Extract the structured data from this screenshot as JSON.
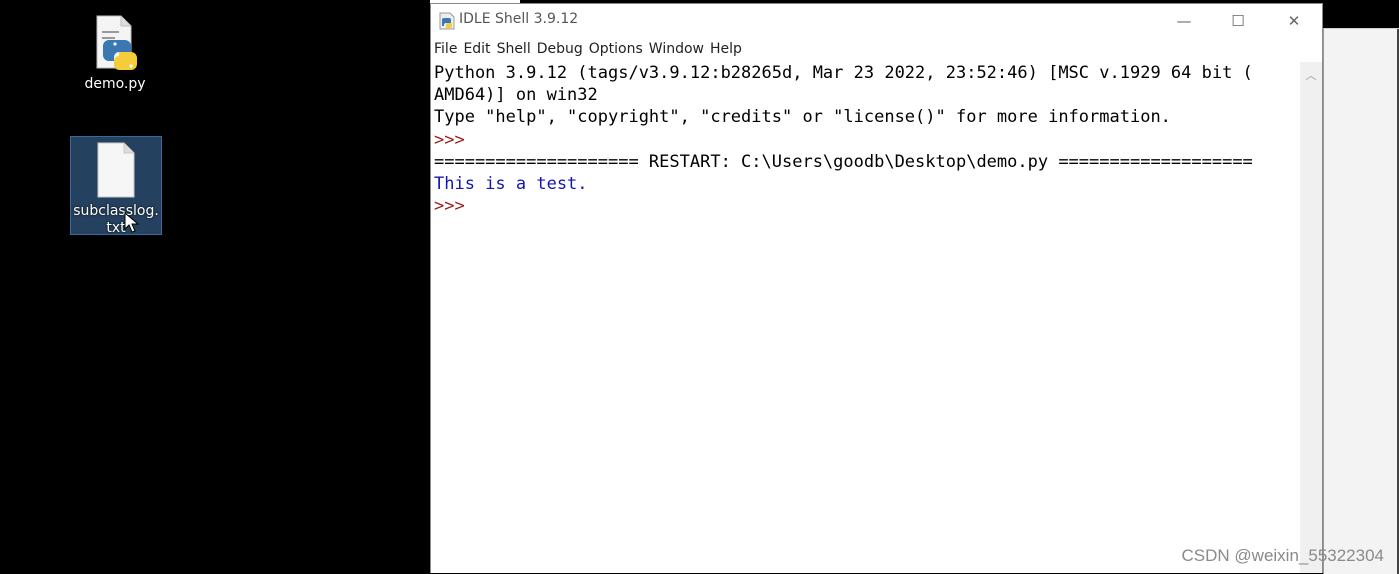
{
  "desktop": {
    "icons": [
      {
        "label": "demo.py",
        "icon": "python-file-icon"
      },
      {
        "label": "subclasslog.txt",
        "icon": "text-file-icon",
        "selected": true
      }
    ]
  },
  "window": {
    "title": "IDLE Shell 3.9.12",
    "controls": {
      "minimize": "—",
      "maximize": "☐",
      "close": "✕"
    },
    "menu": [
      "File",
      "Edit",
      "Shell",
      "Debug",
      "Options",
      "Window",
      "Help"
    ]
  },
  "shell": {
    "banner_line1": "Python 3.9.12 (tags/v3.9.12:b28265d, Mar 23 2022, 23:52:46) [MSC v.1929 64 bit (",
    "banner_line2": "AMD64)] on win32",
    "banner_line3": "Type \"help\", \"copyright\", \"credits\" or \"license()\" for more information.",
    "prompt1": ">>>",
    "restart_line": "==================== RESTART: C:\\Users\\goodb\\Desktop\\demo.py ===================",
    "output_line": "This is a test.",
    "prompt2": ">>>"
  },
  "watermark": "CSDN @weixin_55322304",
  "colors": {
    "prompt": "#9b1b1b",
    "output": "#1414b4",
    "selection": "#24415f"
  }
}
